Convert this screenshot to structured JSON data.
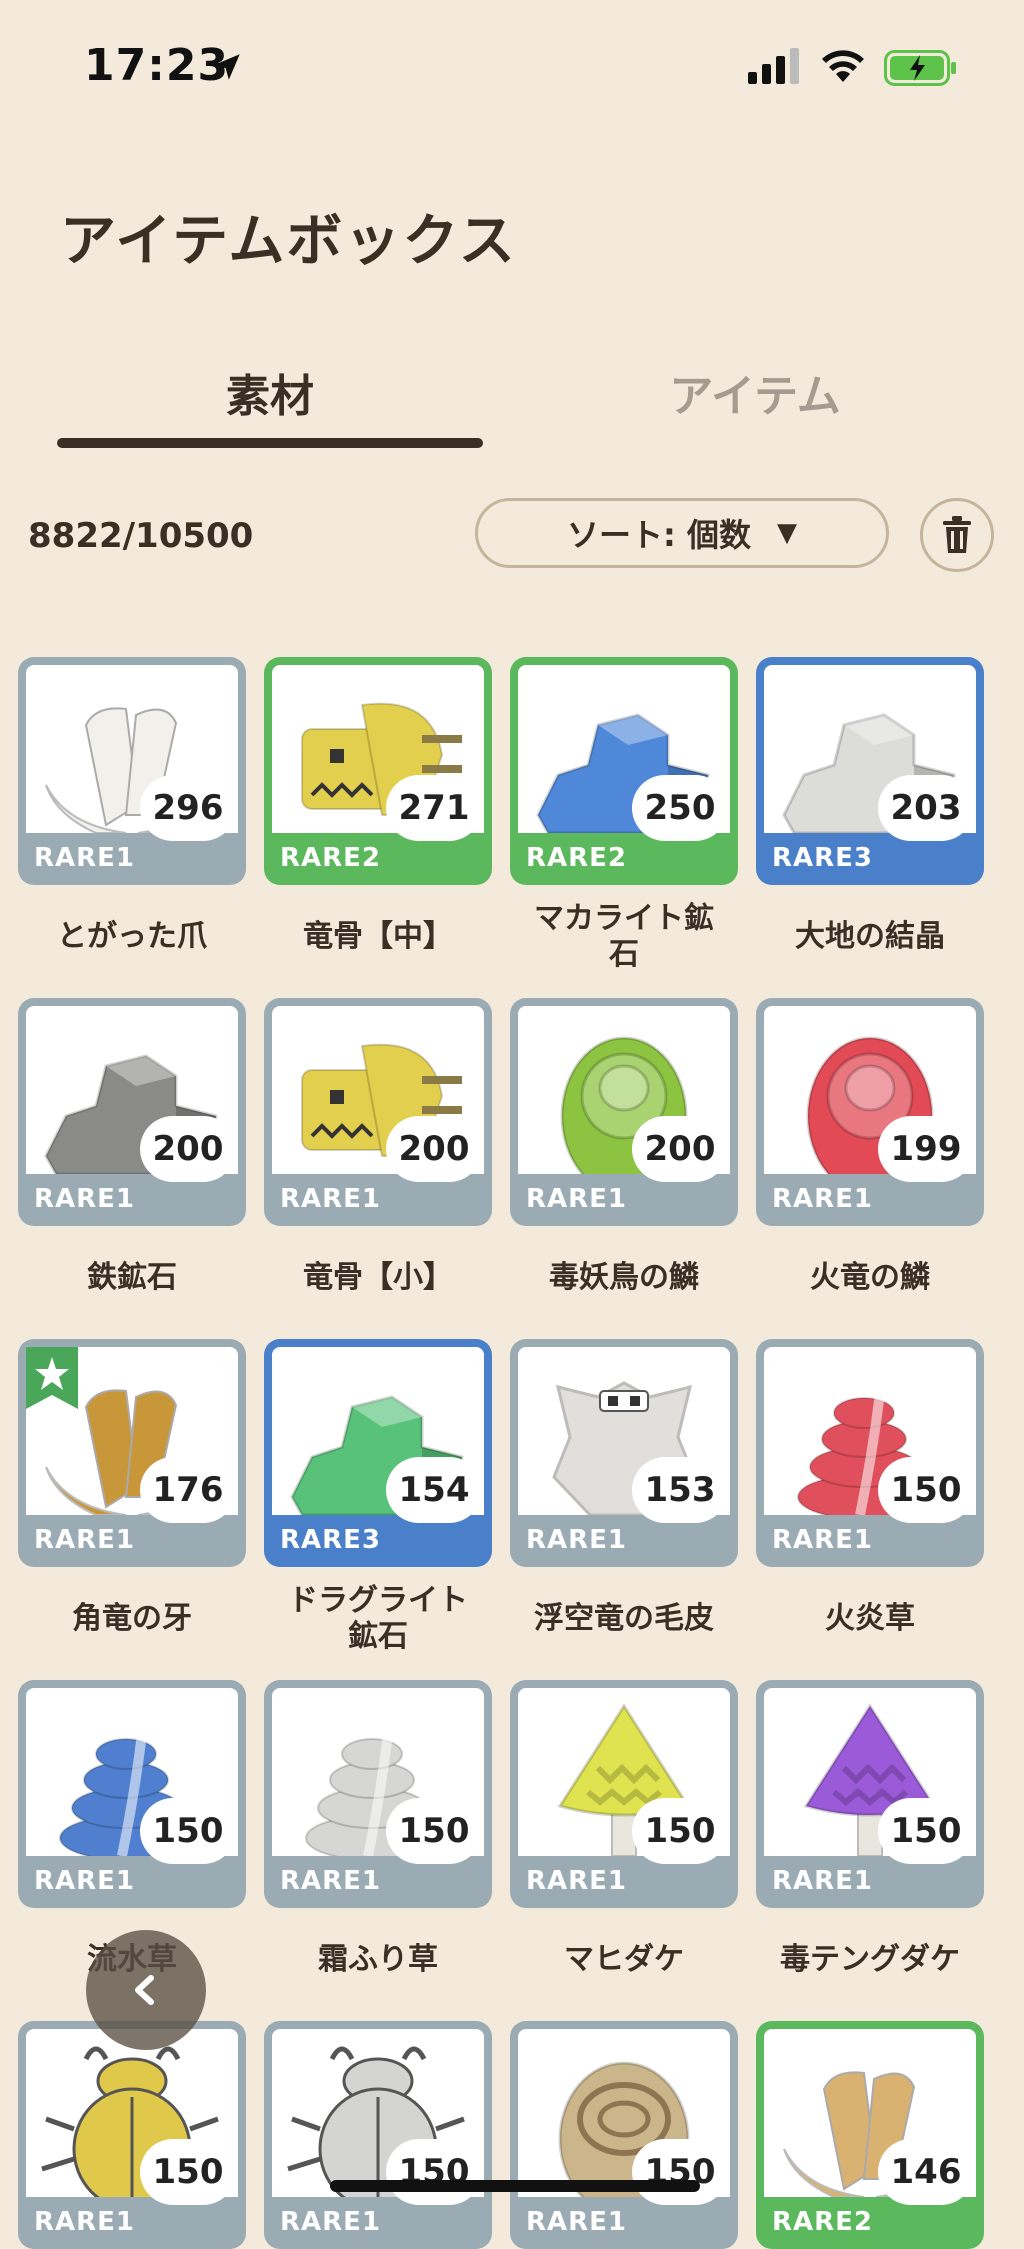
{
  "status": {
    "time": "17:23"
  },
  "header": {
    "title": "アイテムボックス"
  },
  "tabs": [
    {
      "label": "素材",
      "active": true
    },
    {
      "label": "アイテム",
      "active": false
    }
  ],
  "toolbar": {
    "count": "8822/10500",
    "sort_label": "ソート:  個数",
    "sort_caret": "▼"
  },
  "colors": {
    "rare1": "#9aabb3",
    "rare2": "#5cb85c",
    "rare3": "#4a7fc9",
    "text": "#3a2f25",
    "background": "#f3eadb"
  },
  "items": [
    {
      "name": "とがった爪",
      "rarity": "RARE1",
      "qty": "296",
      "icon": "claw-icon",
      "color": "#f2f0ea"
    },
    {
      "name": "竜骨【中】",
      "rarity": "RARE2",
      "qty": "271",
      "icon": "dragon-bone-icon",
      "color": "#e3cf4e"
    },
    {
      "name": "マカライト鉱\n石",
      "rarity": "RARE2",
      "qty": "250",
      "icon": "ore-icon",
      "color": "#4f88d9"
    },
    {
      "name": "大地の結晶",
      "rarity": "RARE3",
      "qty": "203",
      "icon": "crystal-icon",
      "color": "#dcdcd8"
    },
    {
      "name": "鉄鉱石",
      "rarity": "RARE1",
      "qty": "200",
      "icon": "ore-icon",
      "color": "#8a8a88"
    },
    {
      "name": "竜骨【小】",
      "rarity": "RARE1",
      "qty": "200",
      "icon": "dragon-bone-icon",
      "color": "#e3cf4e"
    },
    {
      "name": "毒妖鳥の鱗",
      "rarity": "RARE1",
      "qty": "200",
      "icon": "scale-icon",
      "color": "#8cc441"
    },
    {
      "name": "火竜の鱗",
      "rarity": "RARE1",
      "qty": "199",
      "icon": "scale-icon",
      "color": "#e24a56"
    },
    {
      "name": "角竜の牙",
      "rarity": "RARE1",
      "qty": "176",
      "icon": "fang-icon",
      "color": "#c8973a",
      "starred": true
    },
    {
      "name": "ドラグライト\n鉱石",
      "rarity": "RARE3",
      "qty": "154",
      "icon": "ore-icon",
      "color": "#58c27a"
    },
    {
      "name": "浮空竜の毛皮",
      "rarity": "RARE1",
      "qty": "153",
      "icon": "pelt-icon",
      "color": "#e0dfdc"
    },
    {
      "name": "火炎草",
      "rarity": "RARE1",
      "qty": "150",
      "icon": "herb-icon",
      "color": "#e0505c"
    },
    {
      "name": "流水草",
      "rarity": "RARE1",
      "qty": "150",
      "icon": "herb-icon",
      "color": "#4f7fce"
    },
    {
      "name": "霜ふり草",
      "rarity": "RARE1",
      "qty": "150",
      "icon": "herb-icon",
      "color": "#d6d6d4"
    },
    {
      "name": "マヒダケ",
      "rarity": "RARE1",
      "qty": "150",
      "icon": "mushroom-icon",
      "color": "#dfe350"
    },
    {
      "name": "毒テングダケ",
      "rarity": "RARE1",
      "qty": "150",
      "icon": "mushroom-icon",
      "color": "#9b5ad8"
    },
    {
      "name": "",
      "rarity": "RARE1",
      "qty": "150",
      "icon": "beetle-icon",
      "color": "#e0c84a"
    },
    {
      "name": "",
      "rarity": "RARE1",
      "qty": "150",
      "icon": "beetle-icon",
      "color": "#d4d4d2"
    },
    {
      "name": "",
      "rarity": "RARE1",
      "qty": "150",
      "icon": "shell-icon",
      "color": "#cbb58b"
    },
    {
      "name": "",
      "rarity": "RARE2",
      "qty": "146",
      "icon": "claw-icon",
      "color": "#d9b272"
    }
  ]
}
